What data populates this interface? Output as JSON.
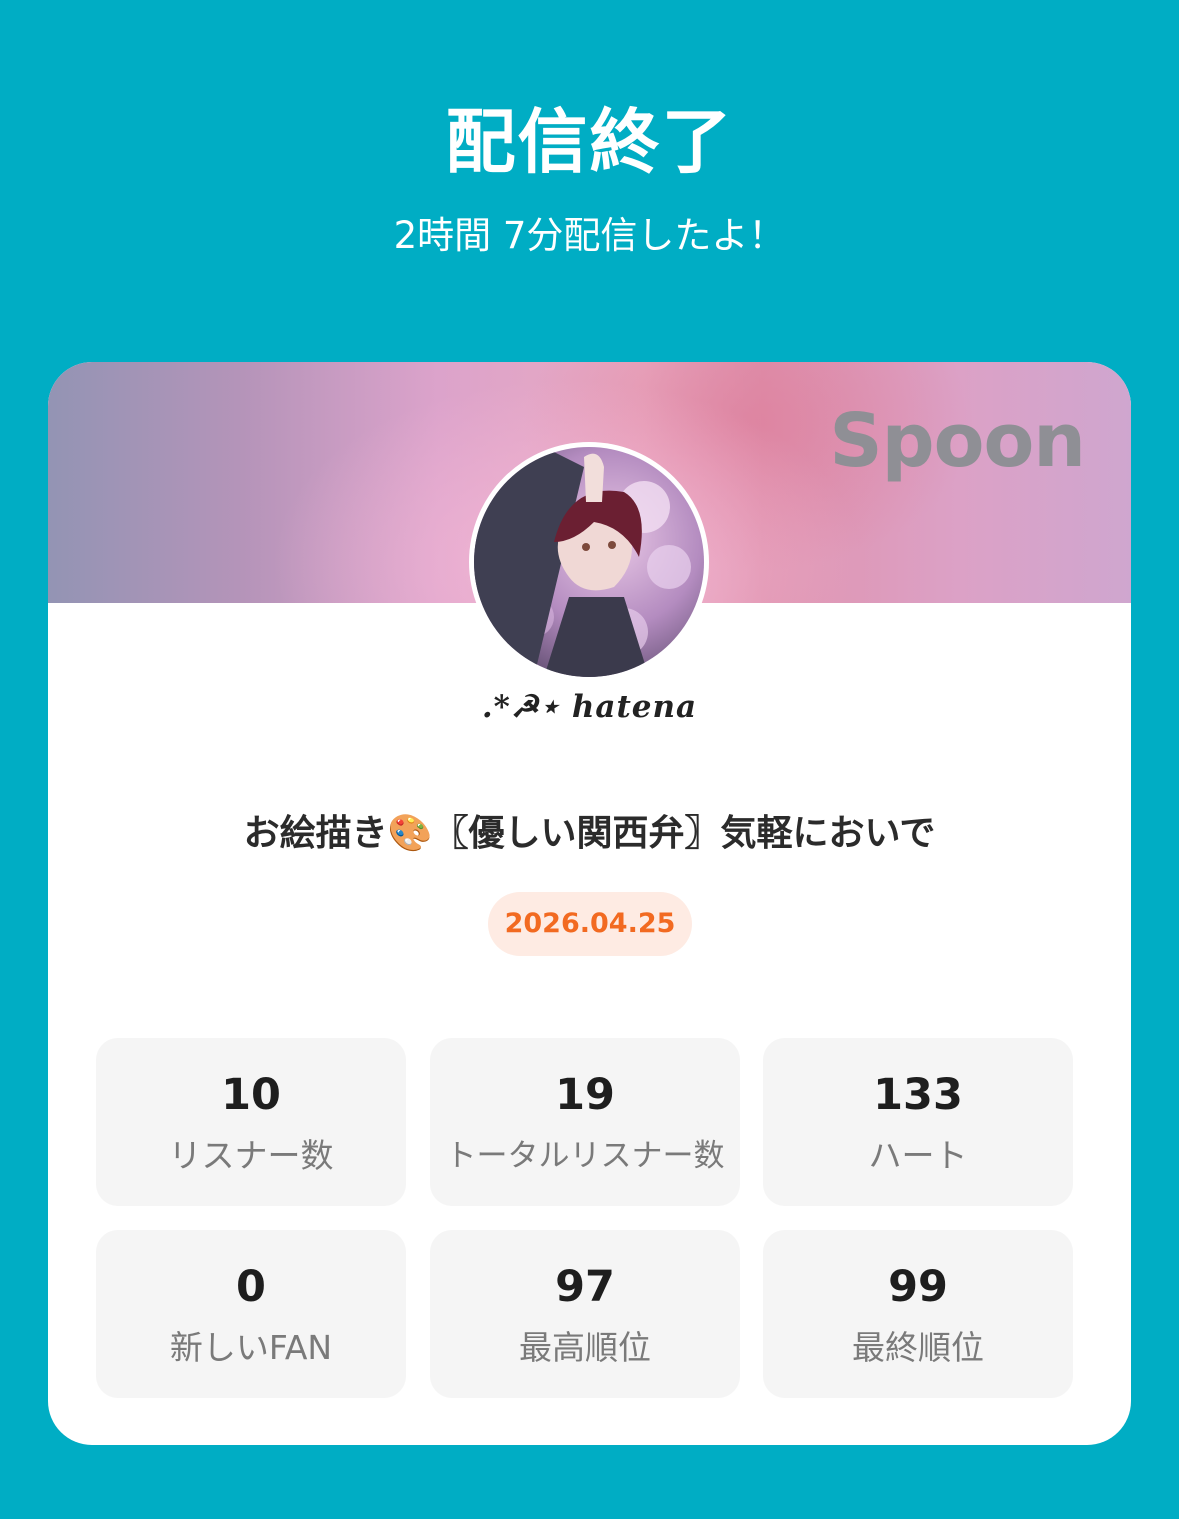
{
  "header": {
    "title": "配信終了",
    "subtitle": "2時間 7分配信したよ！"
  },
  "card": {
    "brand_logo": "Spoon",
    "avatar_icon": "profile-avatar",
    "username": ".*☭⋆ hatena",
    "live_title": "お絵描き🎨〖優しい関西弁〗気軽においで",
    "date": "2026.04.25",
    "stats": [
      {
        "value": "10",
        "label": "リスナー数"
      },
      {
        "value": "19",
        "label": "トータルリスナー数"
      },
      {
        "value": "133",
        "label": "ハート"
      },
      {
        "value": "0",
        "label": "新しいFAN"
      },
      {
        "value": "97",
        "label": "最高順位"
      },
      {
        "value": "99",
        "label": "最終順位"
      }
    ]
  },
  "colors": {
    "background": "#00adc4",
    "card": "#ffffff",
    "date_text": "#f26a21",
    "date_badge_bg": "#feebe3",
    "stat_bg": "#f5f5f5"
  }
}
